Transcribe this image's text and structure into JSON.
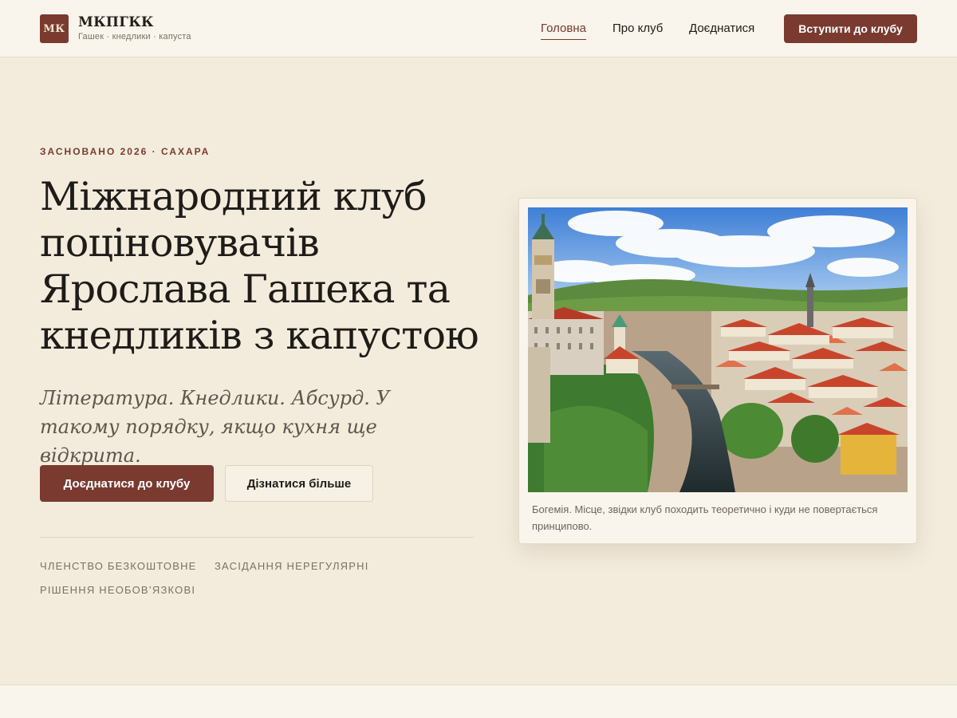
{
  "header": {
    "logo_text": "МК",
    "brand_name": "МКПГКК",
    "tagline": "Гашек · кнедлики · капуста",
    "nav": [
      {
        "label": "Головна",
        "active": true
      },
      {
        "label": "Про клуб",
        "active": false
      },
      {
        "label": "Доєднатися",
        "active": false
      }
    ],
    "cta_label": "Вступити до клубу"
  },
  "hero": {
    "eyebrow": "Засновано 2026 · Сахара",
    "title": "Міжнародний клуб поціновувачів Ярослава Гашека та кнедликів з капустою",
    "subtitle": "Література. Кнедлики. Абсурд. У такому порядку, якщо кухня ще відкрита.",
    "primary_button": "Доєднатися до клубу",
    "secondary_button": "Дізнатися більше",
    "facts": [
      "Членство безкоштовне",
      "Засідання нерегулярні",
      "Рішення необов’язкові"
    ]
  },
  "figure": {
    "image_subject": "bohemian-town-panorama",
    "caption": "Богемія. Місце, звідки клуб походить теоретично і куди не повертається принципово."
  },
  "colors": {
    "accent": "#7a3a30",
    "background": "#f3ecdd",
    "surface": "#f9f5ec",
    "text": "#1f1b18",
    "muted": "#7b7065"
  }
}
